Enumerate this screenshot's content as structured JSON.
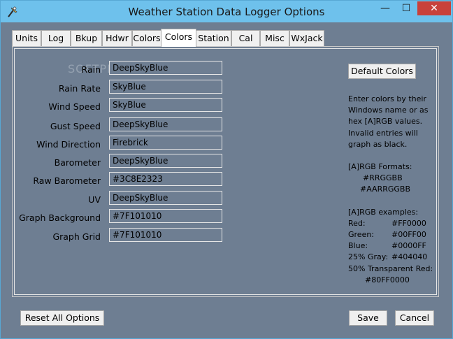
{
  "window": {
    "title": "Weather Station Data Logger Options",
    "controls": {
      "minimize": "—",
      "maximize": "☐",
      "close": "✕"
    }
  },
  "tabs": [
    {
      "label": "Units"
    },
    {
      "label": "Log"
    },
    {
      "label": "Bkup"
    },
    {
      "label": "Hdwr"
    },
    {
      "label": "Colors"
    },
    {
      "label": "Colors",
      "active": true
    },
    {
      "label": "Station"
    },
    {
      "label": "Cal"
    },
    {
      "label": "Misc"
    },
    {
      "label": "WxJack"
    }
  ],
  "fields": [
    {
      "label": "Rain",
      "value": "DeepSkyBlue"
    },
    {
      "label": "Rain Rate",
      "value": "SkyBlue"
    },
    {
      "label": "Wind Speed",
      "value": "SkyBlue"
    },
    {
      "label": "Gust Speed",
      "value": "DeepSkyBlue"
    },
    {
      "label": "Wind Direction",
      "value": "Firebrick"
    },
    {
      "label": "Barometer",
      "value": "DeepSkyBlue"
    },
    {
      "label": "Raw Barometer",
      "value": "#3C8E2323"
    },
    {
      "label": "UV",
      "value": "DeepSkyBlue"
    },
    {
      "label": "Graph Background",
      "value": "#7F101010"
    },
    {
      "label": "Graph Grid",
      "value": "#7F101010"
    }
  ],
  "default_colors_label": "Default Colors",
  "info": {
    "intro": [
      "Enter colors by their",
      "Windows name or as",
      "hex [A]RGB values.",
      "Invalid entries will",
      "graph as black."
    ],
    "formats_title": "[A]RGB Formats:",
    "formats": [
      "#RRGGBB",
      "#AARRGGBB"
    ],
    "examples_title": "[A]RGB examples:",
    "examples": [
      {
        "name": "Red:",
        "value": "#FF0000"
      },
      {
        "name": "Green:",
        "value": "#00FF00"
      },
      {
        "name": "Blue:",
        "value": "#0000FF"
      },
      {
        "name": "25% Gray:",
        "value": "#404040"
      }
    ],
    "transparent_label": "50% Transparent Red:",
    "transparent_value": "#80FF0000"
  },
  "footer": {
    "reset_label": "Reset All Options",
    "save_label": "Save",
    "cancel_label": "Cancel"
  },
  "watermark": "SOFTPEDIA",
  "colors": {
    "titlebar": "#6ec1ec",
    "background": "#6e7e92",
    "close": "#c8413b"
  }
}
